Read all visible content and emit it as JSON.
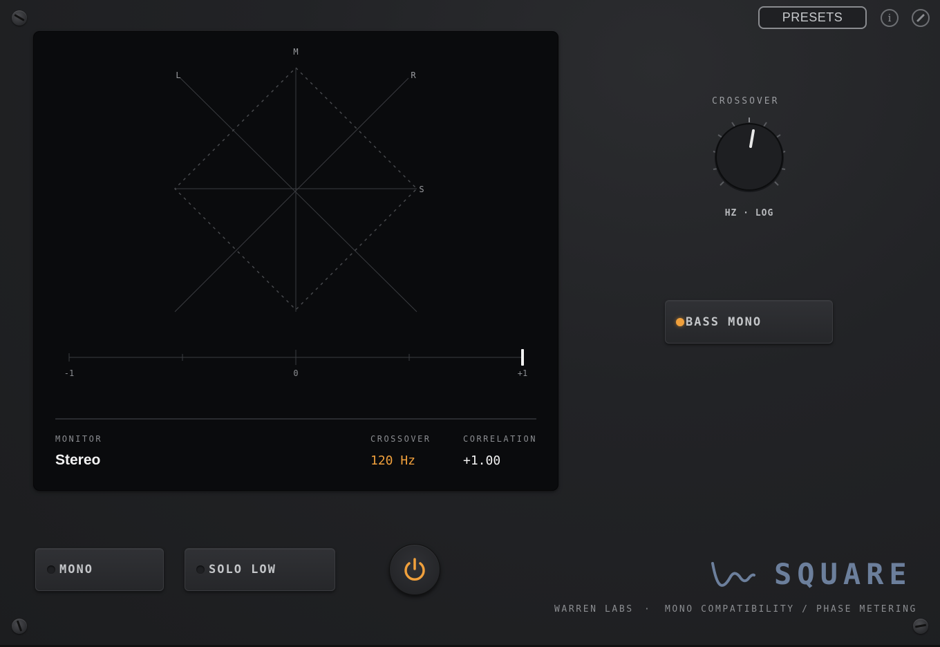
{
  "header": {
    "presets_label": "PRESETS",
    "info_label": "i"
  },
  "scope": {
    "axis_labels": {
      "m": "M",
      "l": "L",
      "r": "R",
      "s": "S"
    },
    "correlation_meter": {
      "tick_labels": [
        "-1",
        "0",
        "+1"
      ],
      "value": 1.0
    },
    "stats": {
      "monitor_label": "MONITOR",
      "monitor_value": "Stereo",
      "crossover_label": "CROSSOVER",
      "crossover_value": "120 Hz",
      "correlation_label": "CORRELATION",
      "correlation_value": "+1.00"
    }
  },
  "crossover_knob": {
    "title": "CROSSOVER",
    "unit_label": "HZ · LOG"
  },
  "buttons": {
    "bass_mono": {
      "label": "BASS MONO",
      "active": true
    },
    "mono": {
      "label": "MONO",
      "active": false
    },
    "solo_low": {
      "label": "SOLO LOW",
      "active": false
    },
    "power": {
      "on": true
    }
  },
  "branding": {
    "product": "SQUARE",
    "company": "WARREN LABS",
    "separator": "·",
    "description": "MONO COMPATIBILITY / PHASE METERING"
  },
  "colors": {
    "accent": "#f0a03c",
    "brand": "#6c7f9c",
    "background": "#1b1c1e"
  },
  "icons": {
    "logo": "wave-logo-icon",
    "power": "power-icon",
    "info": "info-icon",
    "edit": "pencil-icon"
  }
}
